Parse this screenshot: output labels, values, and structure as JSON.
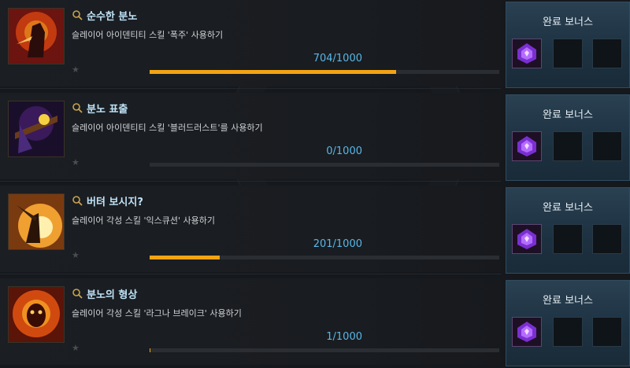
{
  "colors": {
    "title": "#bfe3f7",
    "count": "#58b7e8",
    "progress": "#f2a313"
  },
  "achievements": [
    {
      "title": "순수한 분노",
      "description": "슬레이어 아이덴티티 스킬 '폭주' 사용하기",
      "count": "704/1000",
      "progress": 0.704,
      "bonus_label": "완료 보너스",
      "icon": "rage-slayer-icon"
    },
    {
      "title": "분노 표출",
      "description": "슬레이어 아이덴티티 스킬 '블러드러스트'를 사용하기",
      "count": "0/1000",
      "progress": 0.0,
      "bonus_label": "완료 보너스",
      "icon": "bloodlust-icon"
    },
    {
      "title": "버텨 보시지?",
      "description": "슬레이어 각성 스킬 '익스큐션' 사용하기",
      "count": "201/1000",
      "progress": 0.201,
      "bonus_label": "완료 보너스",
      "icon": "execution-icon"
    },
    {
      "title": "분노의 형상",
      "description": "슬레이어 각성 스킬 '라그나 브레이크' 사용하기",
      "count": "1/1000",
      "progress": 0.001,
      "bonus_label": "완료 보너스",
      "icon": "ragna-break-icon"
    }
  ]
}
